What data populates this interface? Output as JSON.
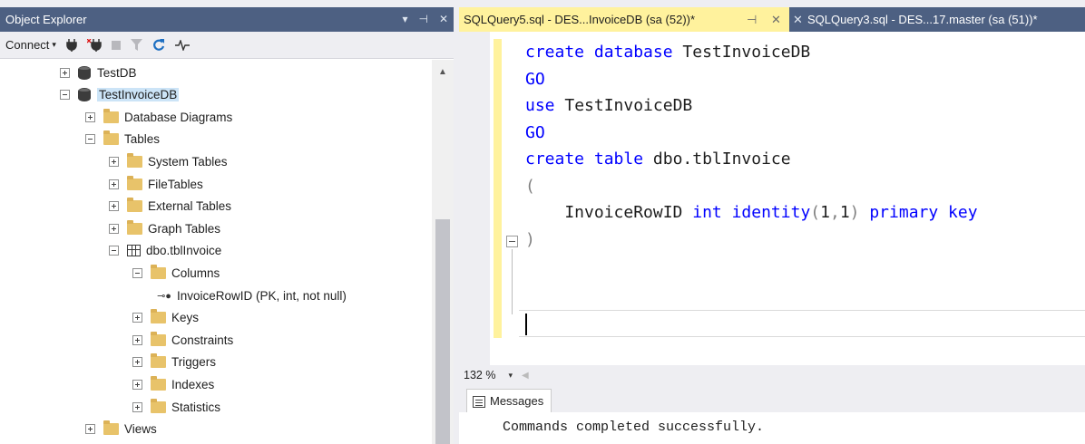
{
  "object_explorer": {
    "title": "Object Explorer",
    "title_buttons": [
      "▾",
      "⊣",
      "✕"
    ],
    "toolbar": {
      "connect_label": "Connect",
      "connect_caret": "▾",
      "icons": [
        "connect-plug-icon",
        "disconnect-plug-icon",
        "stop-icon",
        "filter-icon",
        "refresh-icon",
        "activity-monitor-icon"
      ]
    },
    "tree": [
      {
        "label": "TestDB",
        "icon": "database-icon",
        "expander": "plus"
      },
      {
        "label": "TestInvoiceDB",
        "icon": "database-icon",
        "expander": "minus",
        "selected": true
      },
      {
        "label": "Database Diagrams",
        "icon": "folder-icon",
        "expander": "plus"
      },
      {
        "label": "Tables",
        "icon": "folder-icon",
        "expander": "minus"
      },
      {
        "label": "System Tables",
        "icon": "folder-icon",
        "expander": "plus"
      },
      {
        "label": "FileTables",
        "icon": "folder-icon",
        "expander": "plus"
      },
      {
        "label": "External Tables",
        "icon": "folder-icon",
        "expander": "plus"
      },
      {
        "label": "Graph Tables",
        "icon": "folder-icon",
        "expander": "plus"
      },
      {
        "label": "dbo.tblInvoice",
        "icon": "table-icon",
        "expander": "minus"
      },
      {
        "label": "Columns",
        "icon": "folder-icon",
        "expander": "minus"
      },
      {
        "label": "InvoiceRowID (PK, int, not null)",
        "icon": "primary-key-icon",
        "expander": "none"
      },
      {
        "label": "Keys",
        "icon": "folder-icon",
        "expander": "plus"
      },
      {
        "label": "Constraints",
        "icon": "folder-icon",
        "expander": "plus"
      },
      {
        "label": "Triggers",
        "icon": "folder-icon",
        "expander": "plus"
      },
      {
        "label": "Indexes",
        "icon": "folder-icon",
        "expander": "plus"
      },
      {
        "label": "Statistics",
        "icon": "folder-icon",
        "expander": "plus"
      },
      {
        "label": "Views",
        "icon": "folder-icon",
        "expander": "plus"
      }
    ]
  },
  "tabs": {
    "active": {
      "title": "SQLQuery5.sql - DES...InvoiceDB (sa (52))*",
      "pin": "⊣",
      "close": "✕"
    },
    "inactive": {
      "title": "SQLQuery3.sql - DES...17.master (sa (51))*",
      "close": "✕"
    }
  },
  "editor": {
    "lines": [
      [
        {
          "t": "create database ",
          "c": "kw"
        },
        {
          "t": "TestInvoiceDB",
          "c": "nm"
        }
      ],
      [
        {
          "t": "GO",
          "c": "kw"
        }
      ],
      [
        {
          "t": "use ",
          "c": "kw"
        },
        {
          "t": "TestInvoiceDB",
          "c": "nm"
        }
      ],
      [
        {
          "t": "GO",
          "c": "kw"
        }
      ],
      [
        {
          "t": "create table ",
          "c": "kw"
        },
        {
          "t": "dbo.tblInvoice",
          "c": "nm"
        }
      ],
      [
        {
          "t": "(",
          "c": "gr"
        }
      ],
      [
        {
          "t": "    InvoiceRowID ",
          "c": "nm"
        },
        {
          "t": "int identity",
          "c": "kw"
        },
        {
          "t": "(",
          "c": "gr"
        },
        {
          "t": "1",
          "c": "nm"
        },
        {
          "t": ",",
          "c": "gr"
        },
        {
          "t": "1",
          "c": "nm"
        },
        {
          "t": ") ",
          "c": "gr"
        },
        {
          "t": "primary key",
          "c": "kw"
        }
      ],
      [
        {
          "t": ")",
          "c": "gr"
        }
      ]
    ]
  },
  "zoom": {
    "level": "132 %",
    "caret": "▾"
  },
  "messages": {
    "tab_label": "Messages",
    "text": "Commands completed successfully."
  }
}
